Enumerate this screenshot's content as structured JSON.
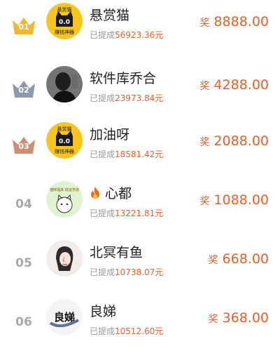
{
  "colors": {
    "accent": "#e8602a",
    "gold_crown": "#f2b433",
    "silver_crown": "#8e98ab",
    "bronze_crown": "#cc8f74",
    "rank_gray": "#a8a8a8"
  },
  "reward_label": "奖",
  "withdrawn_label": "已提成",
  "rankings": [
    {
      "rank": "01",
      "name": "悬赏猫",
      "withdrawn": "56923.36元",
      "reward": "8888.00",
      "crown": "gold",
      "avatar": "cat-logo",
      "logo_top": "悬赏猫",
      "logo_eyes": "0.0",
      "logo_bottom": "赚钱神器"
    },
    {
      "rank": "02",
      "name": "软件库乔合",
      "withdrawn": "23973.84元",
      "reward": "4288.00",
      "crown": "silver",
      "avatar": "man-portrait"
    },
    {
      "rank": "03",
      "name": "加油呀",
      "withdrawn": "18581.42元",
      "reward": "2088.00",
      "crown": "bronze",
      "avatar": "cat-logo",
      "logo_top": "悬赏猫",
      "logo_eyes": "0.0",
      "logo_bottom": "赚钱神器"
    },
    {
      "rank": "04",
      "name": "心都",
      "withdrawn": "13221.81元",
      "reward": "1088.00",
      "crown": "none",
      "avatar": "cartoon-cat",
      "has_fire": true,
      "avatar_text": "猫咪福来 财运亨通"
    },
    {
      "rank": "05",
      "name": "北冥有鱼",
      "withdrawn": "10738.07元",
      "reward": "668.00",
      "crown": "none",
      "avatar": "woman-sketch"
    },
    {
      "rank": "06",
      "name": "良娣",
      "withdrawn": "10512.60元",
      "reward": "368.00",
      "crown": "none",
      "avatar": "calligraphy",
      "avatar_text": "良娣"
    }
  ]
}
